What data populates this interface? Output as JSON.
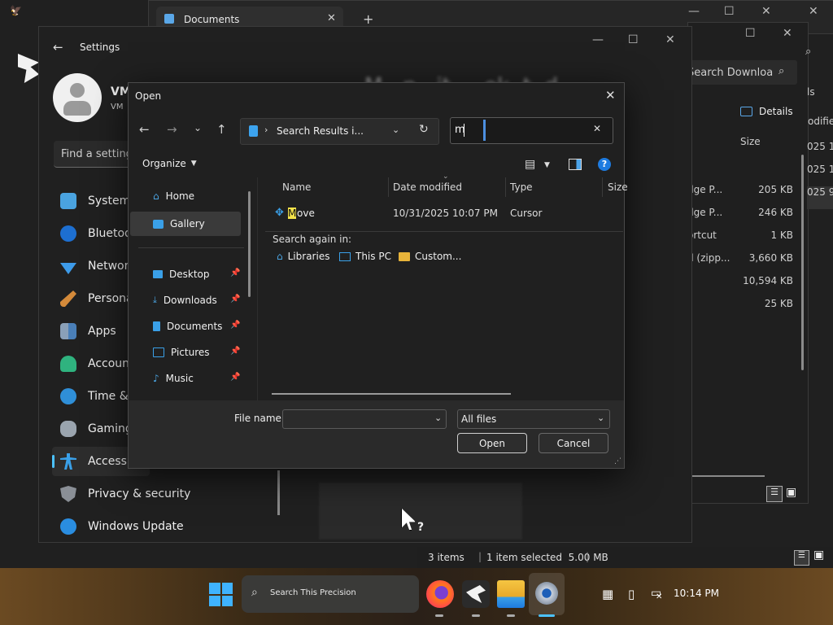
{
  "background": {
    "explorer_tab": "Documents",
    "explorer_search_placeholder": "Search Downloa",
    "details_label": "Details",
    "size_header": "Size",
    "modified_header": "odified",
    "date_fragments": [
      "025 10",
      "025 10",
      "025 9:5"
    ],
    "file_types": [
      "dge P...",
      "dge P...",
      "ortcut",
      "d (zipp...",
      "",
      ""
    ],
    "file_sizes": [
      "205 KB",
      "246 KB",
      "1 KB",
      "3,660 KB",
      "10,594 KB",
      "25 KB"
    ],
    "side_label": "ls",
    "status": {
      "items": "3 items",
      "selected": "1 item selected  5.00 MB"
    }
  },
  "settings": {
    "title": "Settings",
    "user_initials": "VM",
    "user_sub": "VM",
    "find_placeholder": "Find a setting",
    "nav_items": [
      {
        "label": "System",
        "icon": "system-icon"
      },
      {
        "label": "Bluetoo",
        "icon": "bluetooth-icon"
      },
      {
        "label": "Network",
        "icon": "network-icon"
      },
      {
        "label": "Persona",
        "icon": "personalization-icon"
      },
      {
        "label": "Apps",
        "icon": "apps-icon"
      },
      {
        "label": "Account",
        "icon": "accounts-icon"
      },
      {
        "label": "Time &",
        "icon": "time-icon"
      },
      {
        "label": "Gaming",
        "icon": "gaming-icon"
      },
      {
        "label": "Accessib",
        "icon": "accessibility-icon"
      },
      {
        "label": "Privacy & security",
        "icon": "privacy-icon"
      },
      {
        "label": "Windows Update",
        "icon": "windows-update-icon"
      }
    ],
    "blurred_heading": "M   p   it     ok  t  d"
  },
  "dialog": {
    "title": "Open",
    "address_text": "Search Results i...",
    "search_value": "m",
    "organize_label": "Organize",
    "nav": {
      "home": "Home",
      "gallery": "Gallery",
      "desktop": "Desktop",
      "downloads": "Downloads",
      "documents": "Documents",
      "pictures": "Pictures",
      "music": "Music"
    },
    "columns": {
      "name": "Name",
      "date": "Date modified",
      "type": "Type",
      "size": "Size"
    },
    "results": [
      {
        "name_highlight": "M",
        "name_rest": "ove",
        "date": "10/31/2025 10:07 PM",
        "type": "Cursor"
      }
    ],
    "search_again_label": "Search again in:",
    "search_again": [
      "Libraries",
      "This PC",
      "Custom..."
    ],
    "filename_label": "File name:",
    "filename_value": "",
    "filetype_value": "All files",
    "open_label": "Open",
    "cancel_label": "Cancel"
  },
  "taskbar": {
    "search_placeholder": "Search This Precision",
    "time": "10:14 PM"
  },
  "colors": {
    "accent": "#0078d4",
    "highlight": "#f3e24a",
    "folder": "#e8b43a"
  }
}
